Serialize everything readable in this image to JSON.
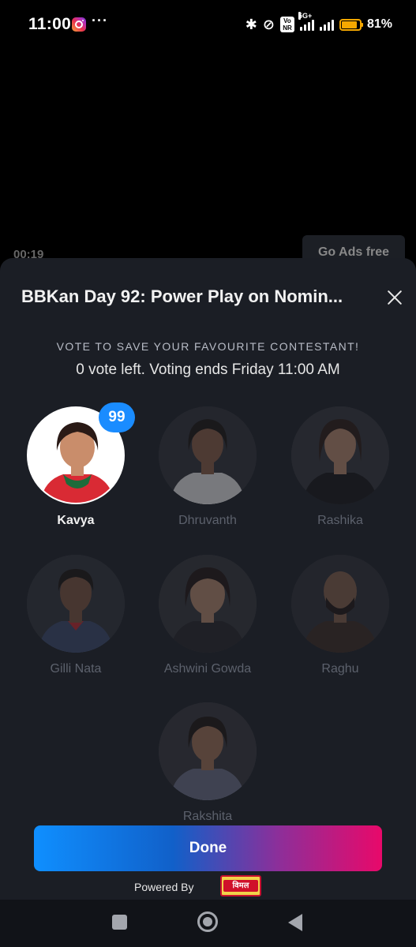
{
  "status_bar": {
    "time": "11:00",
    "more": "···",
    "network": "5G+",
    "volte": "Vo NR",
    "battery": "81%",
    "battery_level": 0.81
  },
  "player": {
    "elapsed": "00:19",
    "ads_free_label": "Go Ads free"
  },
  "sheet": {
    "title": "BBKan Day 92: Power Play on Nomin...",
    "caption": "VOTE TO SAVE YOUR FAVOURITE CONTESTANT!",
    "status": "0 vote left. Voting ends Friday 11:00 AM",
    "contestants": [
      {
        "name": "Kavya",
        "votes": "99",
        "selected": true
      },
      {
        "name": "Dhruvanth"
      },
      {
        "name": "Rashika"
      },
      {
        "name": "Gilli Nata"
      },
      {
        "name": "Ashwini Gowda"
      },
      {
        "name": "Raghu"
      },
      {
        "name": "Rakshita"
      }
    ],
    "done_label": "Done",
    "powered_by": "Powered By",
    "sponsor": "विमल"
  },
  "colors": {
    "sheet_bg": "#1b1e25",
    "badge": "#1a8cff",
    "done_gradient_start": "#0f8fff",
    "done_gradient_end": "#e8096a"
  }
}
